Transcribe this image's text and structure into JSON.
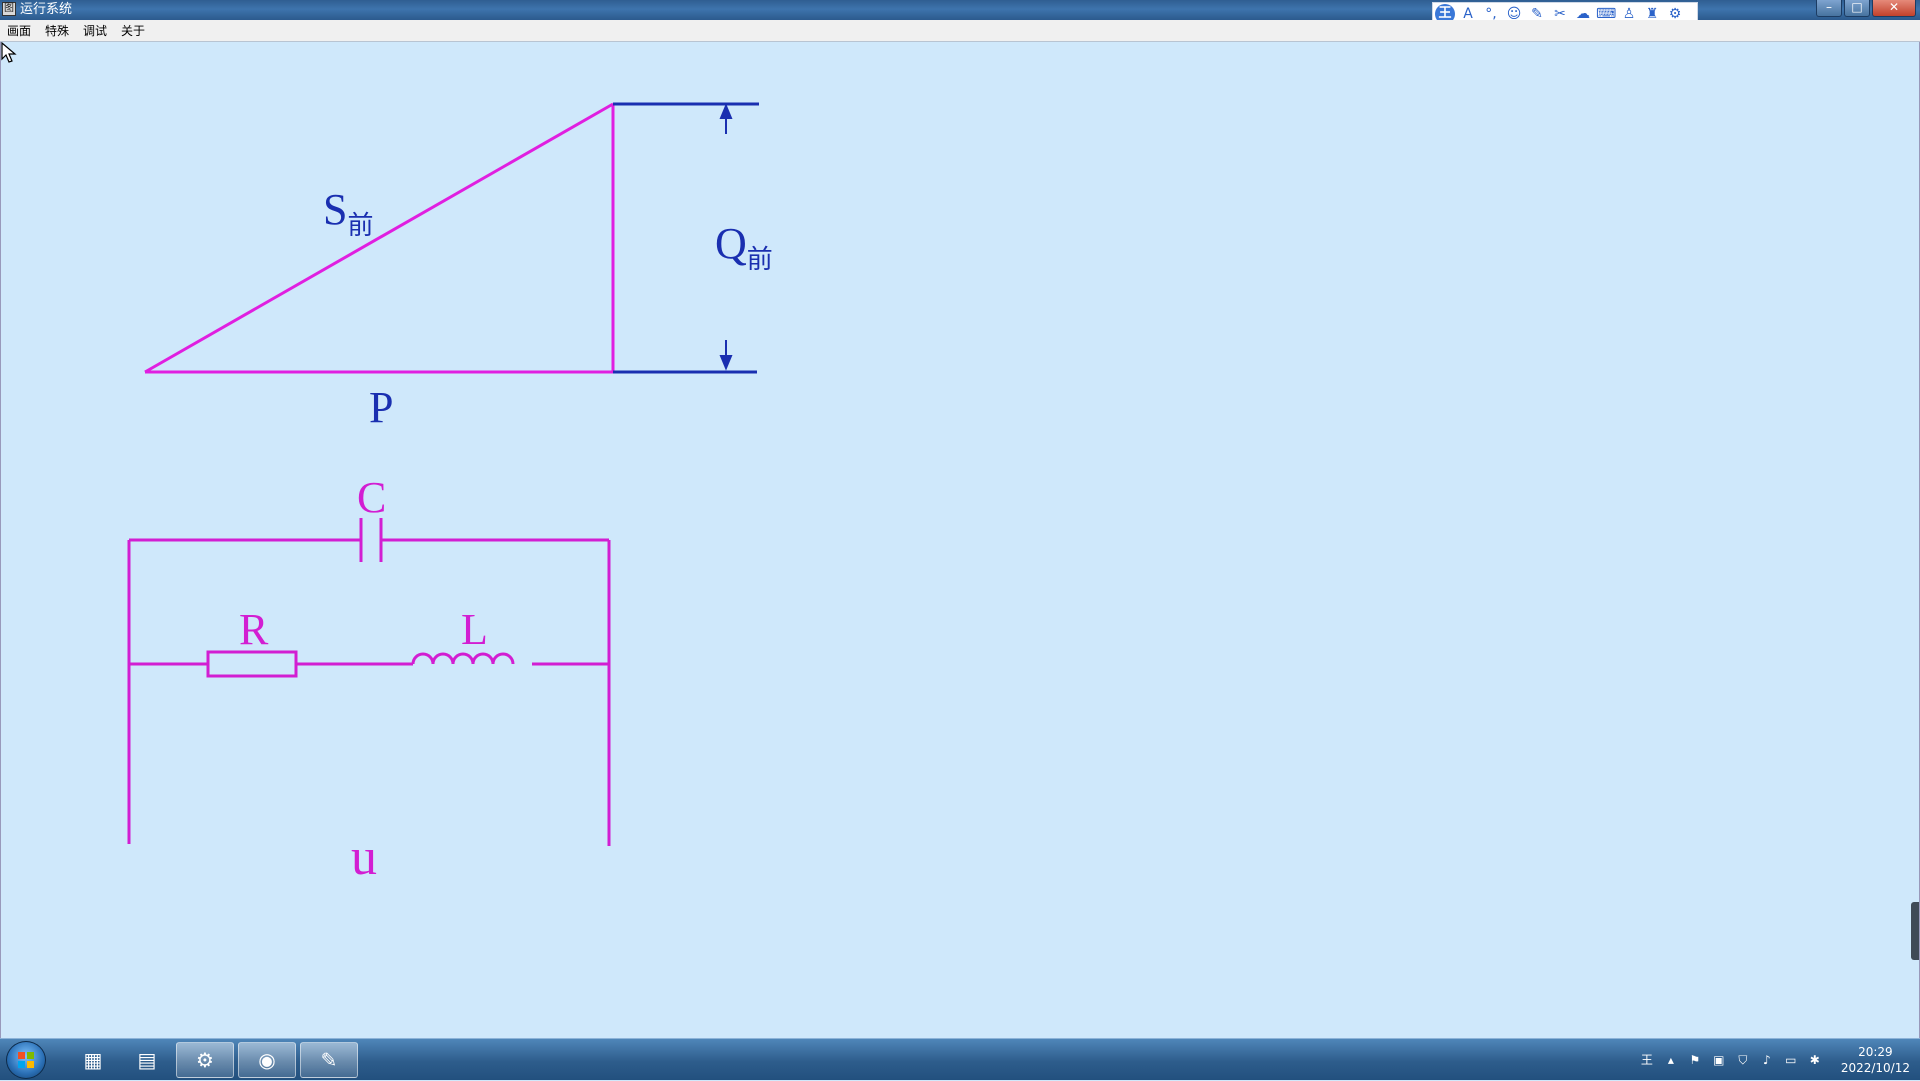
{
  "window": {
    "title": "运行系统",
    "controls": {
      "minimize": "–",
      "maximize": "□",
      "close": "✕"
    }
  },
  "ime_toolbar": {
    "icons": [
      "ime-logo-icon",
      "font-icon",
      "punctuation-icon",
      "emoji-icon",
      "pen-icon",
      "scissors-icon",
      "cloud-icon",
      "keyboard-icon",
      "user-icon",
      "shirt-icon",
      "settings-icon"
    ],
    "logo": "王"
  },
  "menu": {
    "items": [
      "画面",
      "特殊",
      "调试",
      "关于"
    ]
  },
  "diagram": {
    "triangle": {
      "hypotenuse_label": "S",
      "hypotenuse_sub": "前",
      "base_label": "P",
      "side_label": "Q",
      "side_sub": "前"
    },
    "circuit": {
      "capacitor_label": "C",
      "resistor_label": "R",
      "inductor_label": "L",
      "source_label": "u"
    },
    "colors": {
      "triangle": "#e01fe0",
      "dimension": "#1a2fb0",
      "circuit": "#d21ed2"
    }
  },
  "taskbar": {
    "apps": [
      "app-grid-icon",
      "report-icon",
      "config-icon",
      "runtime-eye-icon",
      "paint-icon"
    ],
    "clock_time": "20:29",
    "clock_date": "2022/10/12"
  }
}
